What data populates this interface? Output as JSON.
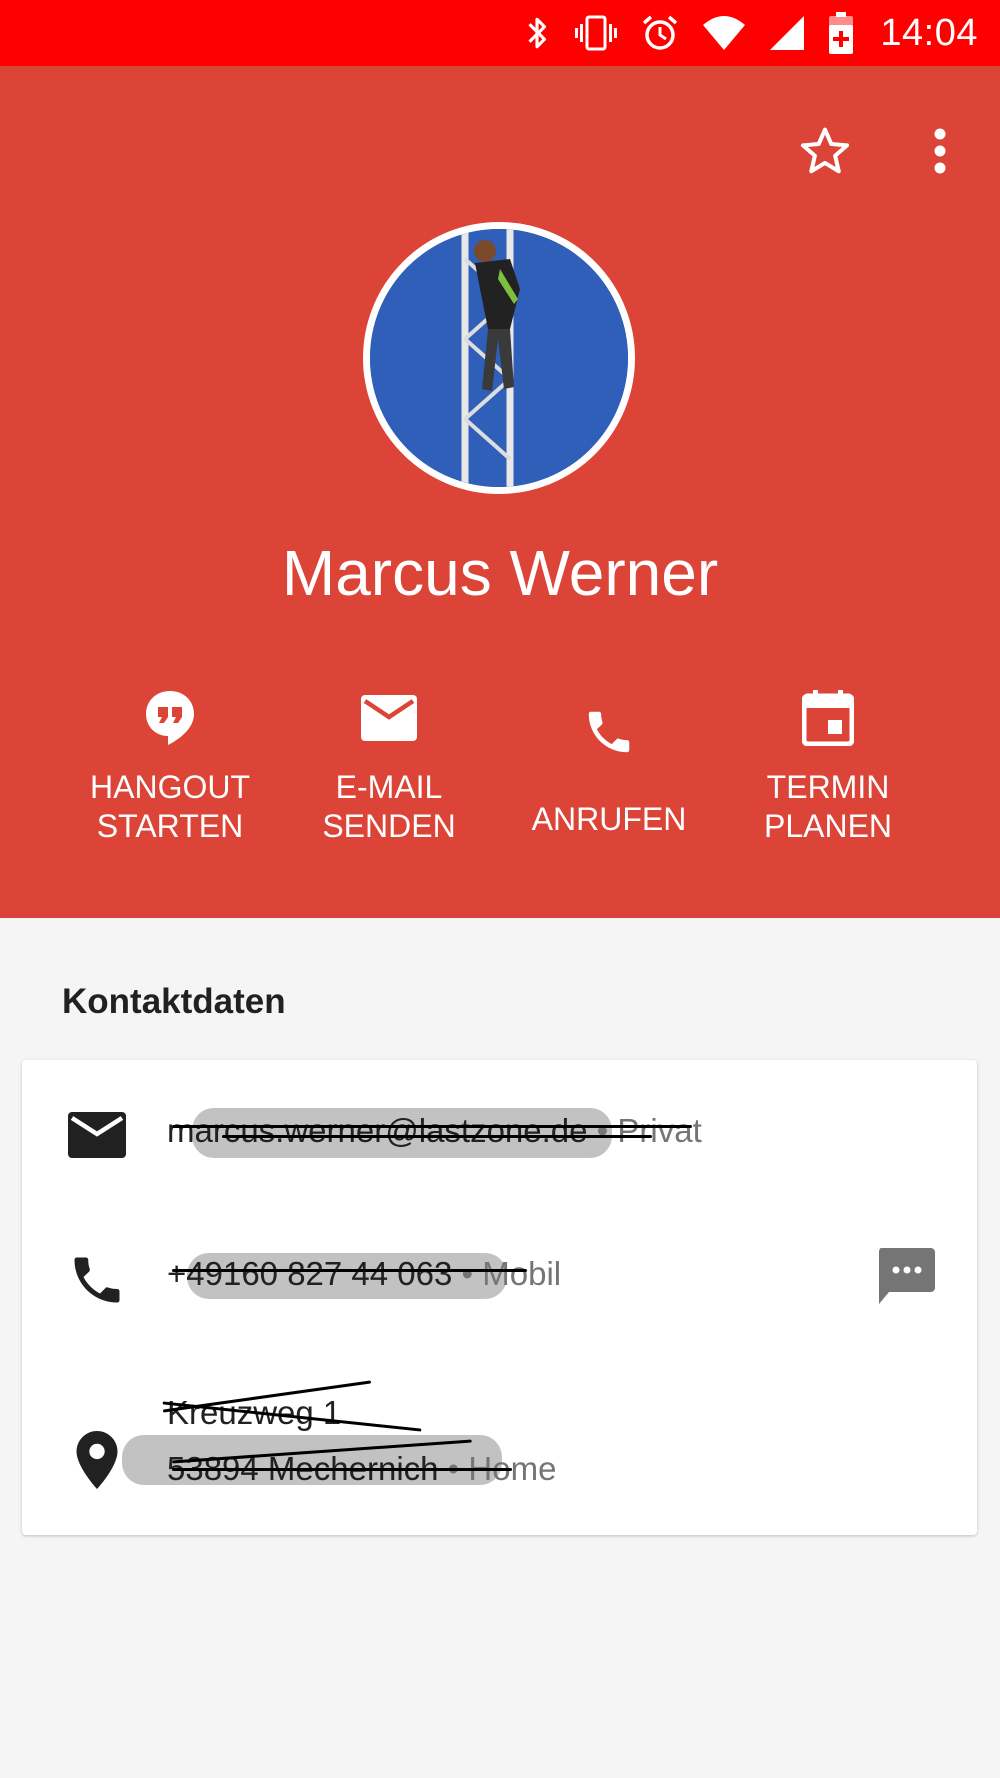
{
  "status_bar": {
    "time": "14:04",
    "color": "#ff0000"
  },
  "header": {
    "color": "#db4437",
    "contact_name": "Marcus Werner",
    "actions": [
      {
        "icon": "hangouts-icon",
        "label": "HANGOUT\nSTARTEN"
      },
      {
        "icon": "email-icon",
        "label": "E-MAIL\nSENDEN"
      },
      {
        "icon": "phone-icon",
        "label": "ANRUFEN"
      },
      {
        "icon": "calendar-icon",
        "label": "TERMIN\nPLANEN"
      }
    ]
  },
  "contact_details": {
    "section_title": "Kontaktdaten",
    "email": {
      "value": "marcus.werner@lastzone.de",
      "separator": " • ",
      "type": "Privat"
    },
    "phone": {
      "value": "+49160 827 44 063",
      "separator": " • ",
      "type": "Mobil"
    },
    "address": {
      "line1": "Kreuzweg 1",
      "line2": "53894 Mechernich",
      "separator": " • ",
      "type": "Home"
    }
  }
}
